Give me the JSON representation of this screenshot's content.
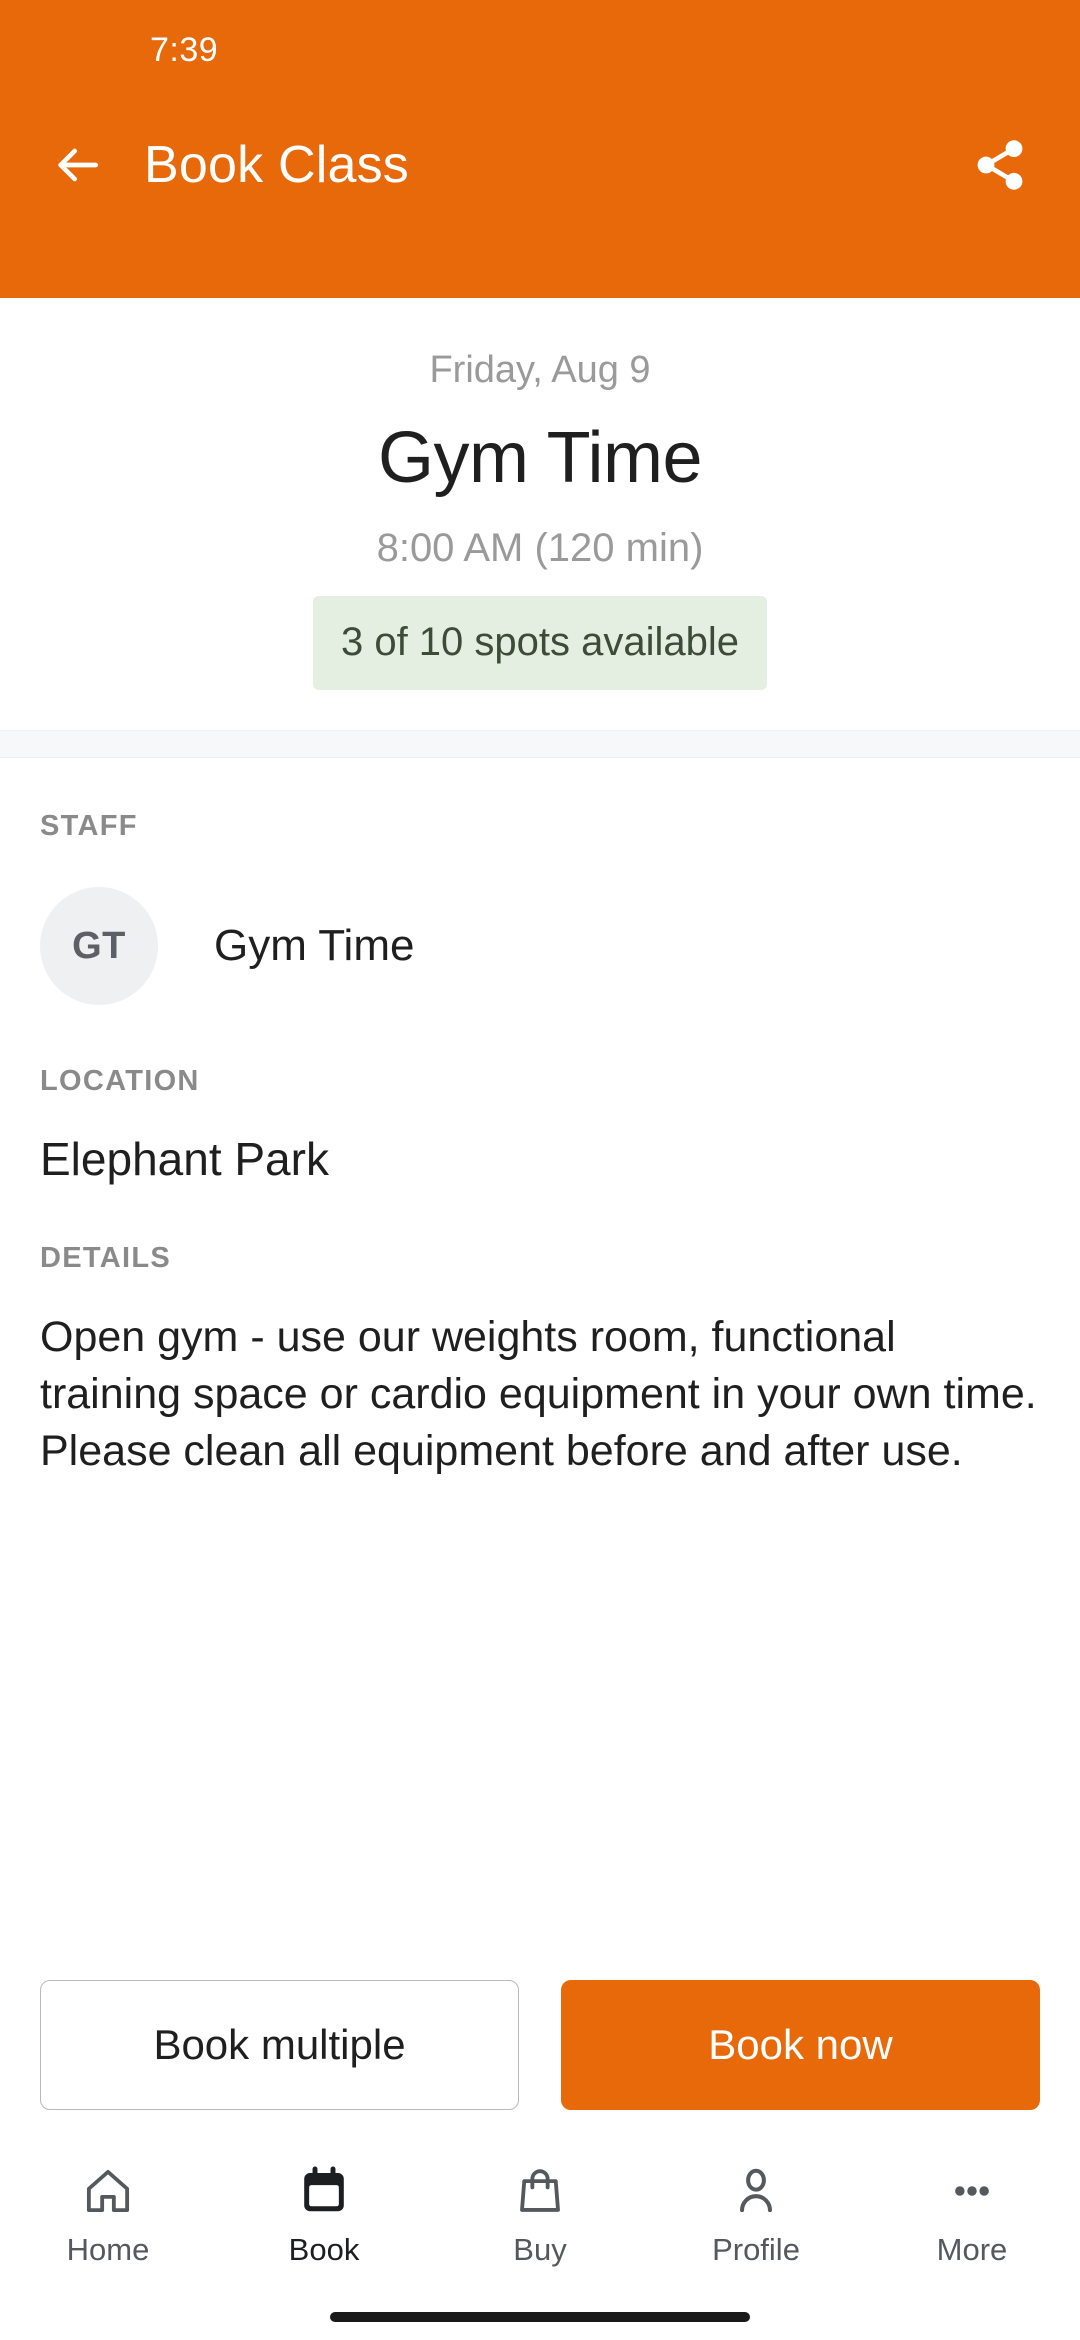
{
  "colors": {
    "brand_orange": "#E8690A",
    "badge_bg": "#E4EFE1",
    "badge_text": "#3D4B39",
    "avatar_bg": "#EEF0F2",
    "muted_text": "#9A9A9A",
    "label_text": "#8A8A8A",
    "body_text": "#1F1F1F"
  },
  "status_bar": {
    "time": "7:39"
  },
  "app_bar": {
    "back_icon": "arrow-left-icon",
    "title": "Book Class",
    "share_icon": "share-icon"
  },
  "summary": {
    "date": "Friday, Aug 9",
    "class_name": "Gym Time",
    "time": "8:00 AM (120 min)",
    "spots_badge": "3 of 10 spots available"
  },
  "sections": {
    "staff": {
      "label": "STAFF",
      "avatar_initials": "GT",
      "name": "Gym Time"
    },
    "location": {
      "label": "LOCATION",
      "value": "Elephant Park"
    },
    "details": {
      "label": "DETAILS",
      "text": "Open gym - use our weights room, functional training space or cardio equipment in your own time.   Please clean all equipment before and after use."
    }
  },
  "actions": {
    "secondary_label": "Book multiple",
    "primary_label": "Book now"
  },
  "bottom_nav": {
    "items": [
      {
        "label": "Home",
        "icon": "home-icon",
        "active": false
      },
      {
        "label": "Book",
        "icon": "calendar-icon",
        "active": true
      },
      {
        "label": "Buy",
        "icon": "shopping-bag-icon",
        "active": false
      },
      {
        "label": "Profile",
        "icon": "person-icon",
        "active": false
      },
      {
        "label": "More",
        "icon": "ellipsis-icon",
        "active": false
      }
    ]
  }
}
